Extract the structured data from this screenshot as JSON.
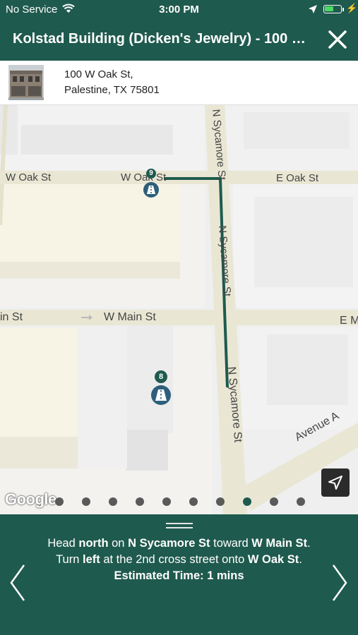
{
  "status_bar": {
    "carrier": "No Service",
    "time": "3:00 PM",
    "battery_level": 0.55,
    "icons": [
      "wifi-icon",
      "location-arrow-icon",
      "battery-icon",
      "charging-bolt-icon"
    ]
  },
  "header": {
    "title": "Kolstad Building (Dicken's Jewelry) - 100 W...",
    "close_icon": "close-icon"
  },
  "address": {
    "line1": "100 W Oak St,",
    "line2": "Palestine, TX 75801"
  },
  "map": {
    "streets": {
      "w_oak_left": "W Oak St",
      "w_oak_mid": "W Oak St",
      "e_oak": "E Oak St",
      "main_left": "in St",
      "w_main": "W Main St",
      "e_main": "E M",
      "sycamore_top": "N Sycamore St",
      "sycamore_mid": "N Sycamore St",
      "sycamore_bottom": "N Sycamore St",
      "avenue_a": "Avenue A"
    },
    "markers": [
      {
        "number": "9"
      },
      {
        "number": "8"
      }
    ],
    "attribution": "Google",
    "route_color": "#1f5a4e"
  },
  "pager": {
    "page_count": 10,
    "active_index": 7
  },
  "directions": {
    "line1": {
      "a": "Head ",
      "b": "north",
      "c": " on ",
      "d": "N Sycamore St",
      "e": " toward ",
      "f": "W Main St",
      "g": "."
    },
    "line2": {
      "a": "Turn ",
      "b": "left",
      "c": " at the 2nd cross street onto ",
      "d": "W Oak St",
      "e": "."
    },
    "line3": "Estimated Time: 1 mins"
  },
  "colors": {
    "brand": "#1f5a4e",
    "marker_blue": "#2e5f7a"
  }
}
